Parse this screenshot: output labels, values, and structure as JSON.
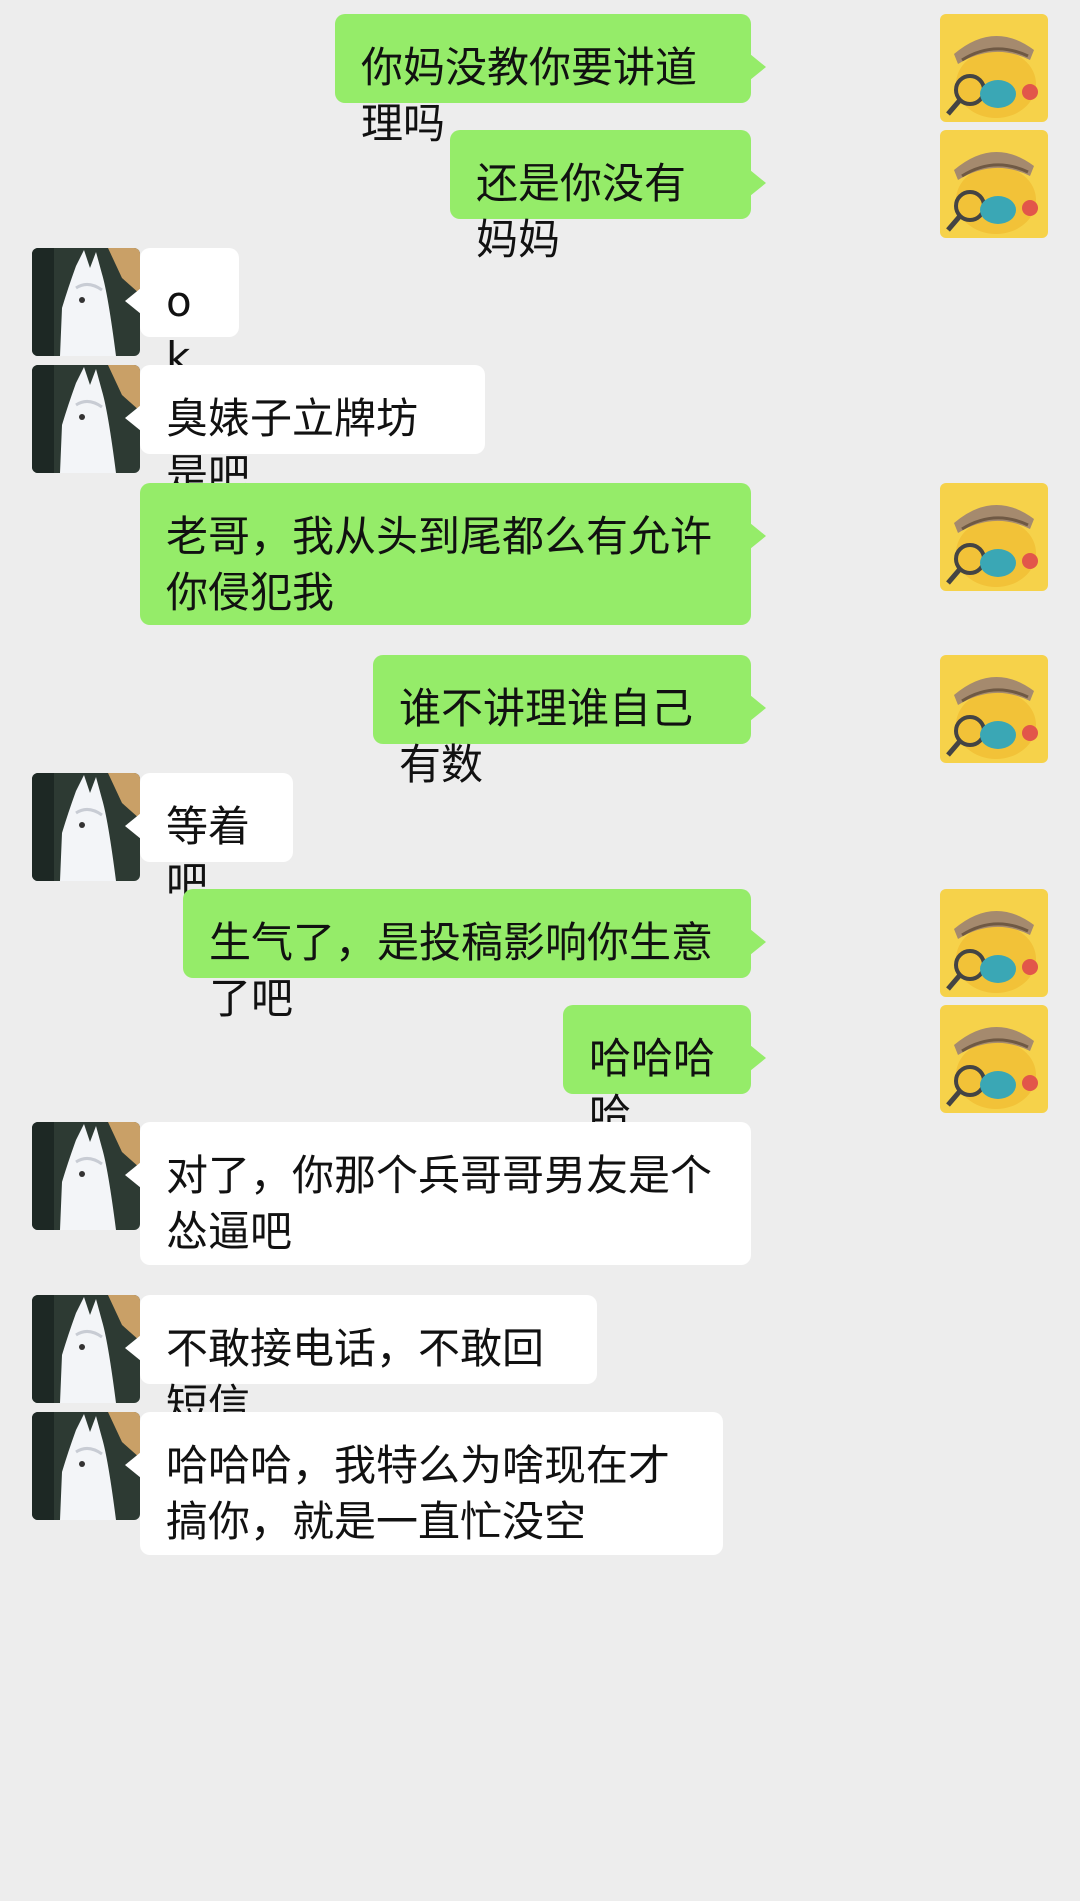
{
  "chat": {
    "messages": [
      {
        "side": "me",
        "text": "你妈没教你要讲道理吗"
      },
      {
        "side": "me",
        "text": "还是你没有妈妈"
      },
      {
        "side": "them",
        "text": "ok"
      },
      {
        "side": "them",
        "text": "臭婊子立牌坊是吧"
      },
      {
        "side": "me",
        "text": "老哥，我从头到尾都么有允许你侵犯我"
      },
      {
        "side": "me",
        "text": "谁不讲理谁自己有数"
      },
      {
        "side": "them",
        "text": "等着吧"
      },
      {
        "side": "me",
        "text": "生气了，是投稿影响你生意了吧"
      },
      {
        "side": "me",
        "text": "哈哈哈哈"
      },
      {
        "side": "them",
        "text": "对了，你那个兵哥哥男友是个怂逼吧"
      },
      {
        "side": "them",
        "text": "不敢接电话，不敢回短信"
      },
      {
        "side": "them",
        "text": "哈哈哈，我特么为啥现在才搞你，就是一直忙没空"
      }
    ]
  },
  "colors": {
    "background": "#ededed",
    "outgoing_bubble": "#95ec69",
    "incoming_bubble": "#ffffff",
    "text": "#111111"
  },
  "icons": {
    "self_avatar": "pikachu-detective-avatar",
    "contact_avatar": "white-rabbit-avatar"
  }
}
